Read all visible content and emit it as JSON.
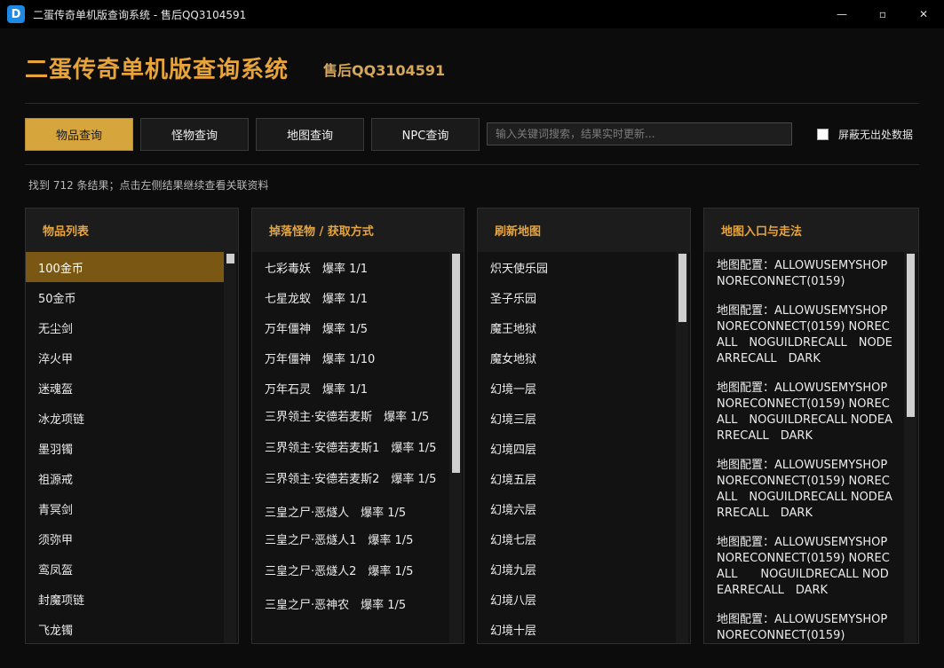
{
  "window": {
    "title": "二蛋传奇单机版查询系统 - 售后QQ3104591",
    "icon_letter": "D",
    "minimize": "—",
    "maximize": "▫",
    "close": "✕"
  },
  "header": {
    "title": "二蛋传奇单机版查询系统",
    "support": "售后QQ3104591"
  },
  "toolbar": {
    "tabs": [
      "物品查询",
      "怪物查询",
      "地图查询",
      "NPC查询"
    ],
    "active_tab": 0,
    "search_placeholder": "输入关键词搜索，结果实时更新...",
    "search_value": "",
    "hide_checkbox_label": "屏蔽无出处数据",
    "hide_checked": false
  },
  "result_text": "找到 712 条结果；点击左侧结果继续查看关联资料",
  "panels": {
    "items": {
      "title": "物品列表",
      "rows": [
        "100金币",
        "50金币",
        "无尘剑",
        "淬火甲",
        "迷魂盔",
        "冰龙项链",
        "墨羽镯",
        "祖源戒",
        "青冥剑",
        "须弥甲",
        "鸾凤盔",
        "封魔项链",
        "飞龙镯"
      ],
      "selected": 0
    },
    "drops": {
      "title": "掉落怪物 / 获取方式",
      "rows": [
        "七彩毒妖　爆率 1/1",
        "七星龙蚁　爆率 1/1",
        "万年僵神　爆率 1/5",
        "万年僵神　爆率 1/10",
        "万年石灵　爆率 1/1",
        "三界领主·安德若麦斯　爆率 1/5",
        "三界领主·安德若麦斯1　爆率 1/5",
        "三界领主·安德若麦斯2　爆率 1/5",
        "三皇之尸·恶燧人　爆率 1/5",
        "三皇之尸·恶燧人1　爆率 1/5",
        "三皇之尸·恶燧人2　爆率 1/5",
        "三皇之尸·恶神农　爆率 1/5"
      ]
    },
    "maps": {
      "title": "刷新地图",
      "rows": [
        "炽天使乐园",
        "圣子乐园",
        "魔王地狱",
        "魔女地狱",
        "幻境一层",
        "幻境三层",
        "幻境四层",
        "幻境五层",
        "幻境六层",
        "幻境七层",
        "幻境九层",
        "幻境八层",
        "幻境十层"
      ]
    },
    "entry": {
      "title": "地图入口与走法",
      "blocks": [
        "地图配置：ALLOWUSEMYSHOP NORECONNECT(0159)",
        "地图配置：ALLOWUSEMYSHOP NORECONNECT(0159) NORECALL　NOGUILDRECALL　NODEARRECALL　DARK",
        "地图配置：ALLOWUSEMYSHOP NORECONNECT(0159) NORECALL　NOGUILDRECALL NODEARRECALL　DARK",
        "地图配置：ALLOWUSEMYSHOP NORECONNECT(0159) NORECALL　NOGUILDRECALL NODEARRECALL　DARK",
        "地图配置：ALLOWUSEMYSHOP NORECONNECT(0159) NORECALL　　NOGUILDRECALL NODEARRECALL　DARK",
        "地图配置：ALLOWUSEMYSHOP NORECONNECT(0159)"
      ]
    }
  },
  "colors": {
    "accent": "#e8a43a",
    "tab_active": "#d6a53c",
    "selected_row": "#7a5712",
    "background": "#0c0c0c"
  }
}
